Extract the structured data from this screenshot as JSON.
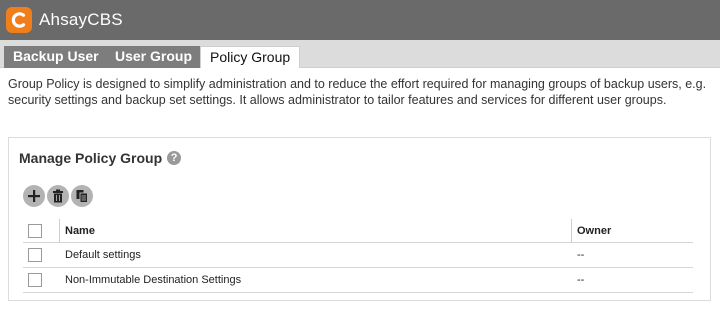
{
  "app": {
    "title": "AhsayCBS",
    "logo_color": "#f07e1b"
  },
  "tabs": [
    {
      "label": "Backup User",
      "active": false
    },
    {
      "label": "User Group",
      "active": false
    },
    {
      "label": "Policy Group",
      "active": true
    }
  ],
  "description": "Group Policy is designed to simplify administration and to reduce the effort required for managing groups of backup users, e.g. security settings and backup set settings. It allows administrator to tailor features and services for different user groups.",
  "panel": {
    "title": "Manage Policy Group",
    "help_icon": "question-circle-icon"
  },
  "toolbar": {
    "add_icon": "plus-icon",
    "delete_icon": "trash-icon",
    "copy_icon": "copy-icon"
  },
  "table": {
    "columns": [
      "Name",
      "Owner"
    ],
    "rows": [
      {
        "name": "Default settings",
        "owner": "--"
      },
      {
        "name": "Non-Immutable Destination Settings",
        "owner": "--"
      }
    ]
  }
}
